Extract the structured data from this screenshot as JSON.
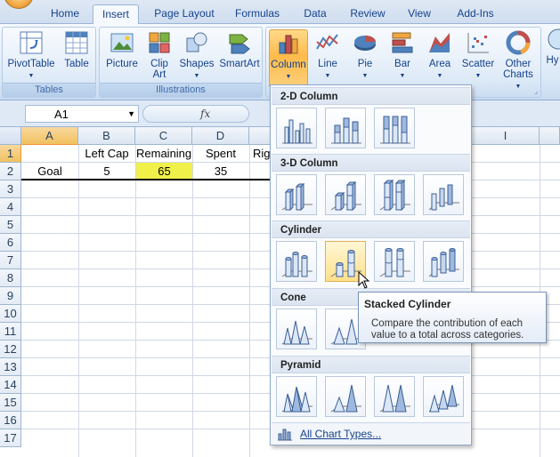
{
  "ribbon_tabs": [
    "Home",
    "Insert",
    "Page Layout",
    "Formulas",
    "Data",
    "Review",
    "View",
    "Add-Ins"
  ],
  "active_tab": "Insert",
  "groups": {
    "tables": {
      "label": "Tables",
      "buttons": [
        {
          "label": "PivotTable",
          "icon": "pivottable-icon"
        },
        {
          "label": "Table",
          "icon": "table-icon"
        }
      ]
    },
    "illustrations": {
      "label": "Illustrations",
      "buttons": [
        {
          "label": "Picture",
          "icon": "picture-icon"
        },
        {
          "label": "Clip Art",
          "icon": "clipart-icon"
        },
        {
          "label": "Shapes",
          "icon": "shapes-icon"
        },
        {
          "label": "SmartArt",
          "icon": "smartart-icon"
        }
      ]
    },
    "charts": {
      "buttons": [
        {
          "label": "Column",
          "icon": "column-chart-icon"
        },
        {
          "label": "Line",
          "icon": "line-chart-icon"
        },
        {
          "label": "Pie",
          "icon": "pie-chart-icon"
        },
        {
          "label": "Bar",
          "icon": "bar-chart-icon"
        },
        {
          "label": "Area",
          "icon": "area-chart-icon"
        },
        {
          "label": "Scatter",
          "icon": "scatter-chart-icon"
        },
        {
          "label": "Other Charts",
          "icon": "other-charts-icon"
        }
      ],
      "overflow_label": "Hy"
    }
  },
  "formula_bar": {
    "name_box": "A1",
    "fx_label": "fx"
  },
  "columns": [
    "A",
    "B",
    "C",
    "D",
    "E",
    "I"
  ],
  "rows": [
    "1",
    "2",
    "3",
    "4",
    "5",
    "6",
    "7",
    "8",
    "9",
    "10",
    "11",
    "12",
    "13",
    "14",
    "15",
    "16",
    "17"
  ],
  "cells": {
    "B1": "Left Cap",
    "C1": "Remaining",
    "D1": "Spent",
    "E1": "Rig",
    "A2": "Goal",
    "B2": "5",
    "C2": "65",
    "D2": "35"
  },
  "chart_menu": {
    "sections": [
      {
        "title": "2-D Column",
        "count": 3
      },
      {
        "title": "3-D Column",
        "count": 4
      },
      {
        "title": "Cylinder",
        "count": 4
      },
      {
        "title": "Cone",
        "count": 4
      },
      {
        "title": "Pyramid",
        "count": 4
      }
    ],
    "footer_link": "All Chart Types..."
  },
  "tooltip": {
    "title": "Stacked Cylinder",
    "body": "Compare the contribution of each value to a total across categories."
  },
  "colors": {
    "accent": "#15428b",
    "highlight_cell": "#f0f04a",
    "selected_header": "#f1c15f"
  }
}
